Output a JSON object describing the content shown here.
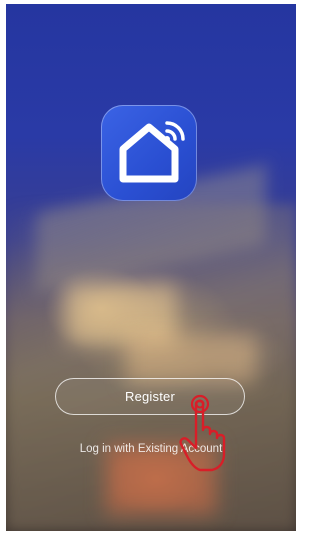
{
  "background": {
    "description_icon": "blurred-house-photo"
  },
  "app_icon": {
    "icon": "smart-home-icon",
    "color": "#2a4fd2"
  },
  "register_button": {
    "label": "Register"
  },
  "login_link": {
    "label": "Log in with Existing Account"
  },
  "hand_pointer": {
    "icon": "tap-hand-icon",
    "color": "#d81e28"
  }
}
